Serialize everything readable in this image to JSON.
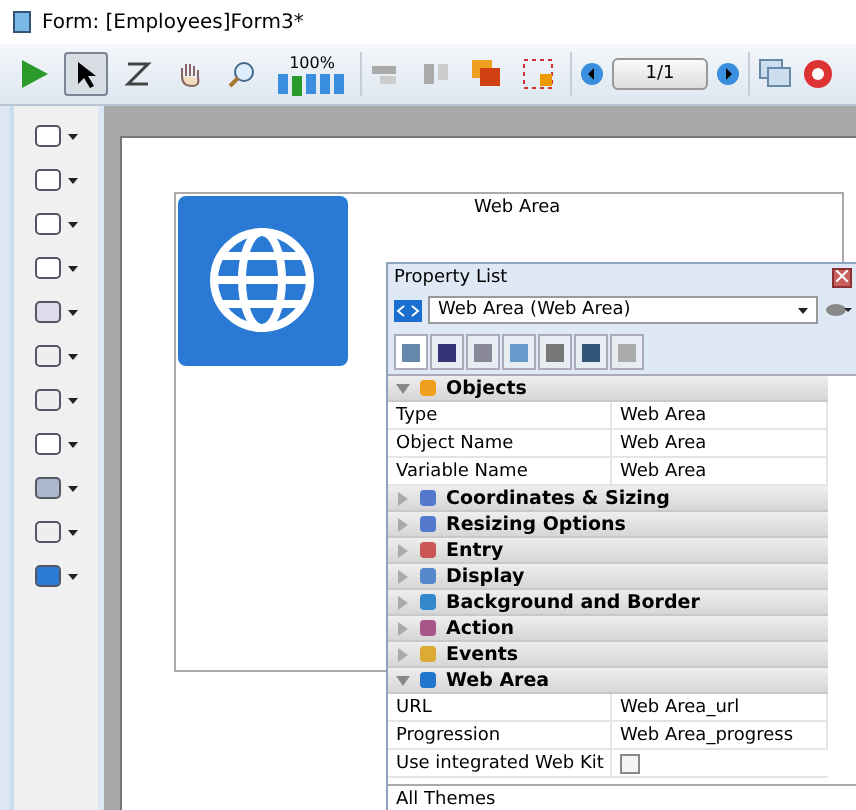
{
  "window": {
    "title": "Form: [Employees]Form3*"
  },
  "toolbar": {
    "zoom_label": "100%",
    "page": "1/1",
    "tools": [
      {
        "kind": "run",
        "selected": false
      },
      {
        "kind": "pointer",
        "selected": true
      },
      {
        "kind": "order",
        "selected": false
      },
      {
        "kind": "hand",
        "selected": false
      },
      {
        "kind": "zoom",
        "selected": false
      }
    ]
  },
  "form": {
    "web_area_label": "Web Area"
  },
  "property_list": {
    "title": "Property List",
    "object": "Web Area (Web Area)",
    "tabs": [
      {
        "selected": true
      },
      {
        "selected": false
      },
      {
        "selected": false
      },
      {
        "selected": false
      },
      {
        "selected": false
      },
      {
        "selected": false
      },
      {
        "selected": false
      }
    ],
    "sections": [
      {
        "title": "Objects",
        "expanded": true,
        "rows": [
          {
            "kind": "text",
            "name": "Type",
            "value": "Web Area"
          },
          {
            "kind": "text",
            "name": "Object Name",
            "value": "Web Area"
          },
          {
            "kind": "text",
            "name": "Variable Name",
            "value": "Web Area"
          }
        ]
      },
      {
        "title": "Coordinates & Sizing",
        "expanded": false
      },
      {
        "title": "Resizing Options",
        "expanded": false
      },
      {
        "title": "Entry",
        "expanded": false
      },
      {
        "title": "Display",
        "expanded": false
      },
      {
        "title": "Background and Border",
        "expanded": false
      },
      {
        "title": "Action",
        "expanded": false
      },
      {
        "title": "Events",
        "expanded": false
      },
      {
        "title": "Web Area",
        "expanded": true,
        "rows": [
          {
            "kind": "text",
            "name": "URL",
            "value": "Web Area_url"
          },
          {
            "kind": "text",
            "name": "Progression",
            "value": "Web Area_progress"
          },
          {
            "kind": "checkbox",
            "name": "Use integrated Web Kit",
            "checked": false
          }
        ]
      }
    ],
    "footer": "All Themes"
  }
}
